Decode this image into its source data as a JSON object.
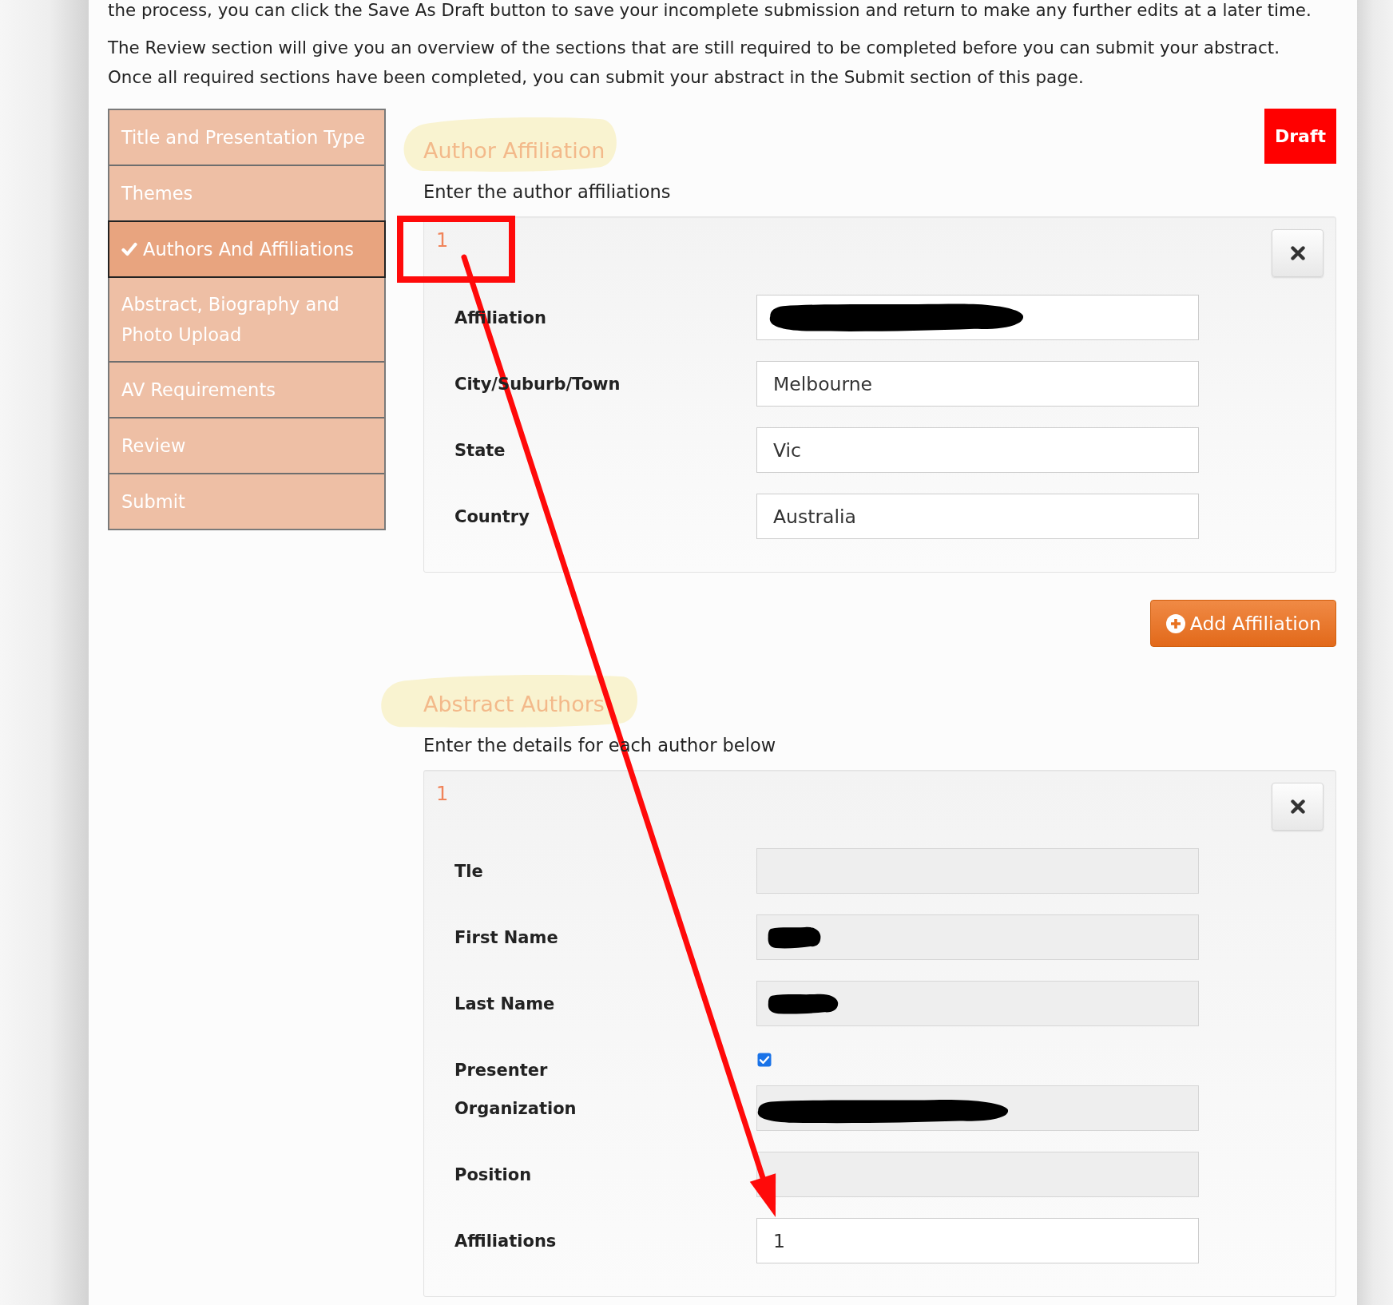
{
  "intro": {
    "cut_line": "the process, you can click the Save As Draft button to save your incomplete submission and return to make any further edits at a later time.",
    "paragraph": "The Review section will give you an overview of the sections that are still required to be completed before you can submit your abstract. Once all required sections have been completed, you can submit your abstract in the Submit section of this page."
  },
  "sidebar": {
    "items": [
      {
        "label": "Title and Presentation Type",
        "selected": false,
        "completed": false
      },
      {
        "label": "Themes",
        "selected": false,
        "completed": false
      },
      {
        "label": "Authors And Affiliations",
        "selected": true,
        "completed": true
      },
      {
        "label": "Abstract, Biography and Photo Upload",
        "selected": false,
        "completed": false
      },
      {
        "label": "AV Requirements",
        "selected": false,
        "completed": false
      },
      {
        "label": "Review",
        "selected": false,
        "completed": false
      },
      {
        "label": "Submit",
        "selected": false,
        "completed": false
      }
    ]
  },
  "status_badge": {
    "label": "Draft"
  },
  "author_affiliation": {
    "title": "Author Affiliation",
    "highlighted": true,
    "hint": "Enter the author affiliations",
    "entries": [
      {
        "number": "1",
        "fields": [
          {
            "kind": "text",
            "label": "Affiliation",
            "disabled": false,
            "redacted": true
          },
          {
            "kind": "text",
            "label": "City/Suburb/Town",
            "value": "Melbourne",
            "disabled": false,
            "redacted": false
          },
          {
            "kind": "text",
            "label": "State",
            "value": "Vic",
            "disabled": false,
            "redacted": false
          },
          {
            "kind": "text",
            "label": "Country",
            "value": "Australia",
            "disabled": false,
            "redacted": false
          }
        ]
      }
    ],
    "add_button": {
      "label": "Add Affiliation"
    }
  },
  "abstract_authors": {
    "title": "Abstract Authors",
    "highlighted": true,
    "hint": "Enter the details for each author below",
    "entries": [
      {
        "number": "1",
        "fields": [
          {
            "kind": "text",
            "label": "Tle",
            "disabled": true,
            "redacted": false
          },
          {
            "kind": "text",
            "label": "First Name",
            "disabled": true,
            "redacted": true
          },
          {
            "kind": "text",
            "label": "Last Name",
            "disabled": true,
            "redacted": true
          },
          {
            "kind": "checkbox",
            "label": "Presenter",
            "checked": true
          },
          {
            "kind": "text",
            "label": "Organization",
            "disabled": true,
            "redacted": true
          },
          {
            "kind": "text",
            "label": "Position",
            "disabled": true,
            "redacted": false
          },
          {
            "kind": "text",
            "label": "Affiliations",
            "value": "1",
            "disabled": false,
            "redacted": false
          }
        ]
      }
    ]
  },
  "annotations": [
    {
      "kind": "frame"
    },
    {
      "kind": "arrow"
    }
  ]
}
